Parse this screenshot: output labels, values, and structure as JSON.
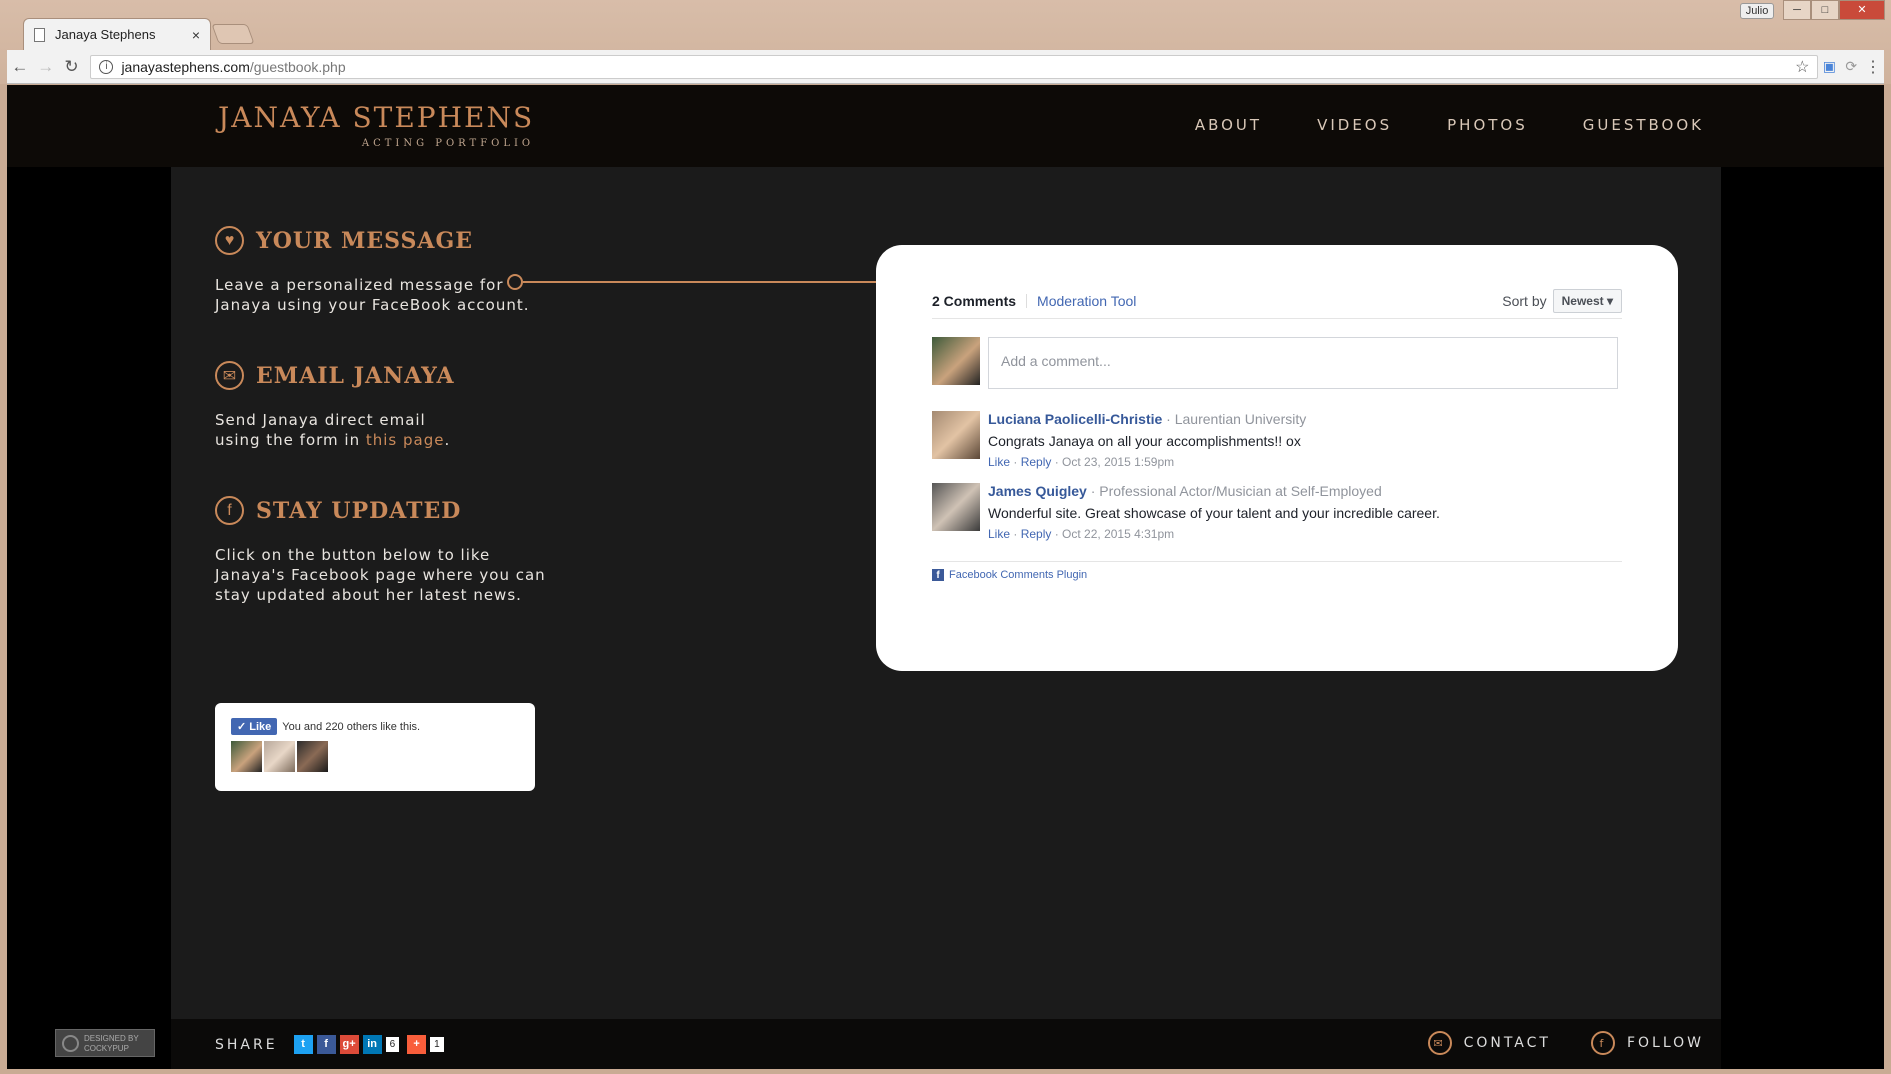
{
  "browser": {
    "tab_title": "Janaya Stephens",
    "tab_close": "×",
    "url_host": "janayastephens.com",
    "url_path": "/guestbook.php",
    "profile": "Julio"
  },
  "site": {
    "logo_name": "JANAYA STEPHENS",
    "logo_sub": "ACTING PORTFOLIO",
    "nav": [
      "ABOUT",
      "VIDEOS",
      "PHOTOS",
      "GUESTBOOK"
    ]
  },
  "sections": {
    "message": {
      "title": "YOUR MESSAGE",
      "text_line1": "Leave a personalized message for",
      "text_line2": "Janaya using your FaceBook account."
    },
    "email": {
      "title": "EMAIL JANAYA",
      "text_line1": "Send Janaya direct email",
      "text_line2_prefix": "using the form in ",
      "link": "this page",
      "text_line2_suffix": "."
    },
    "updated": {
      "title": "STAY UPDATED",
      "text_line1": "Click on the button below to like",
      "text_line2": "Janaya's Facebook page where you can",
      "text_line3": "stay updated about her latest news."
    }
  },
  "like_box": {
    "button": "Like",
    "text": "You and 220 others like this."
  },
  "comments": {
    "count": "2 Comments",
    "moderation": "Moderation Tool",
    "sort_label": "Sort by",
    "sort_value": "Newest ▾",
    "placeholder": "Add a comment...",
    "items": [
      {
        "name": "Luciana Paolicelli-Christie",
        "meta": " · Laurentian University",
        "text": "Congrats Janaya on all your accomplishments!! ox",
        "like": "Like",
        "reply": "Reply",
        "date": "Oct 23, 2015 1:59pm"
      },
      {
        "name": "James Quigley",
        "meta": " · Professional Actor/Musician at Self-Employed",
        "text": "Wonderful site. Great showcase of your talent and your incredible career.",
        "like": "Like",
        "reply": "Reply",
        "date": "Oct 22, 2015 4:31pm"
      }
    ],
    "plugin": "Facebook Comments Plugin"
  },
  "footer": {
    "designed": "DESIGNED BY COCKYPUP",
    "share": "SHARE",
    "share_count_1": "6",
    "share_count_2": "1",
    "contact": "CONTACT",
    "follow": "FOLLOW"
  },
  "colors": {
    "accent": "#c9895a",
    "fb_blue": "#4267b2"
  }
}
